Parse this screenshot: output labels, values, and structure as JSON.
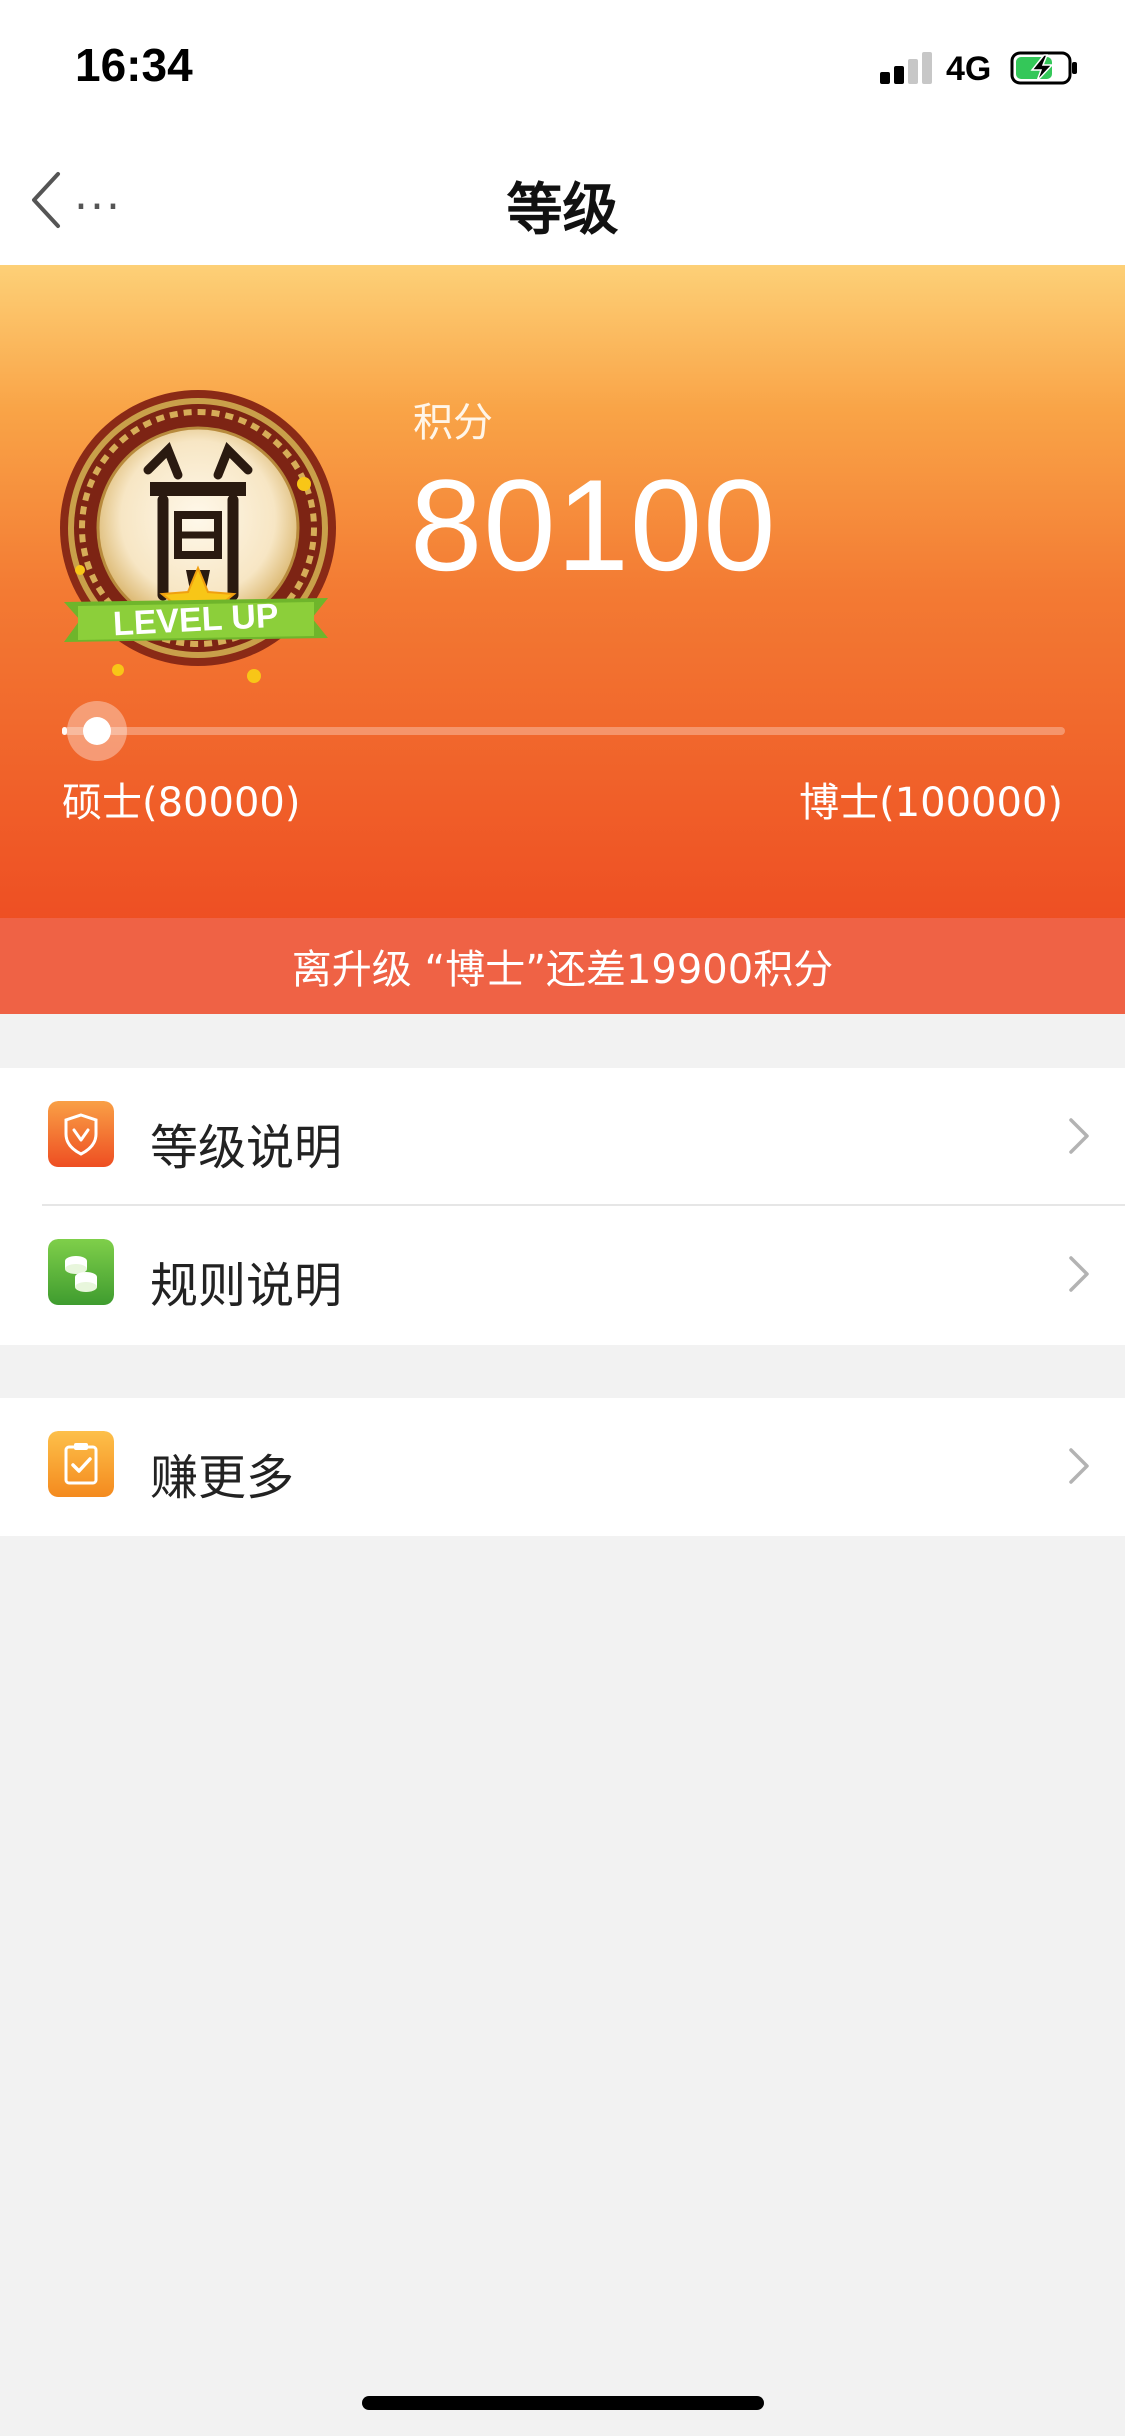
{
  "status_bar": {
    "time": "16:34",
    "network": "4G",
    "signal_bars": 4,
    "signal_active": 2,
    "battery_icon": "battery-charging-icon"
  },
  "nav": {
    "title": "等级",
    "back_icon": "chevron-left-icon",
    "more_label": "..."
  },
  "hero": {
    "points_label": "积分",
    "points_value": "80100",
    "badge_text": "LEVEL UP",
    "current_level_label": "硕士(80000)",
    "next_level_label": "博士(100000)",
    "progress_fraction": 0.005,
    "colors": {
      "gradient_top": "#fdd077",
      "gradient_bottom": "#ee4f23"
    }
  },
  "upgrade_banner": {
    "text": "离升级 “博士”还差19900积分"
  },
  "menu": {
    "group1": [
      {
        "label": "等级说明",
        "icon": "shield-icon",
        "icon_color": "#f26a2c"
      },
      {
        "label": "规则说明",
        "icon": "coins-icon",
        "icon_color": "#5cb33e"
      }
    ],
    "group2": [
      {
        "label": "赚更多",
        "icon": "clipboard-check-icon",
        "icon_color": "#f7a028"
      }
    ]
  }
}
